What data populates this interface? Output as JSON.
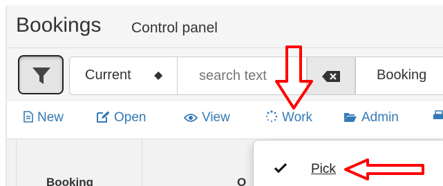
{
  "header": {
    "title": "Bookings",
    "subtitle": "Control panel"
  },
  "toolbar": {
    "status_select": {
      "value": "Current",
      "caret": "↕"
    },
    "search": {
      "placeholder": "search text"
    },
    "type_select": {
      "value": "Booking"
    }
  },
  "actions": [
    {
      "label": "New",
      "icon": "file-icon"
    },
    {
      "label": "Open",
      "icon": "edit-icon"
    },
    {
      "label": "View",
      "icon": "eye-icon"
    },
    {
      "label": "Work",
      "icon": "spinner-icon"
    },
    {
      "label": "Admin",
      "icon": "folder-icon"
    }
  ],
  "table": {
    "columns": [
      "Booking",
      "O"
    ]
  },
  "dropdown": {
    "items": [
      {
        "label": "Pick",
        "checked": true
      }
    ]
  },
  "colors": {
    "link": "#337ab7",
    "annotation": "#ff0000",
    "panel_bg": "#f5f5f5"
  }
}
